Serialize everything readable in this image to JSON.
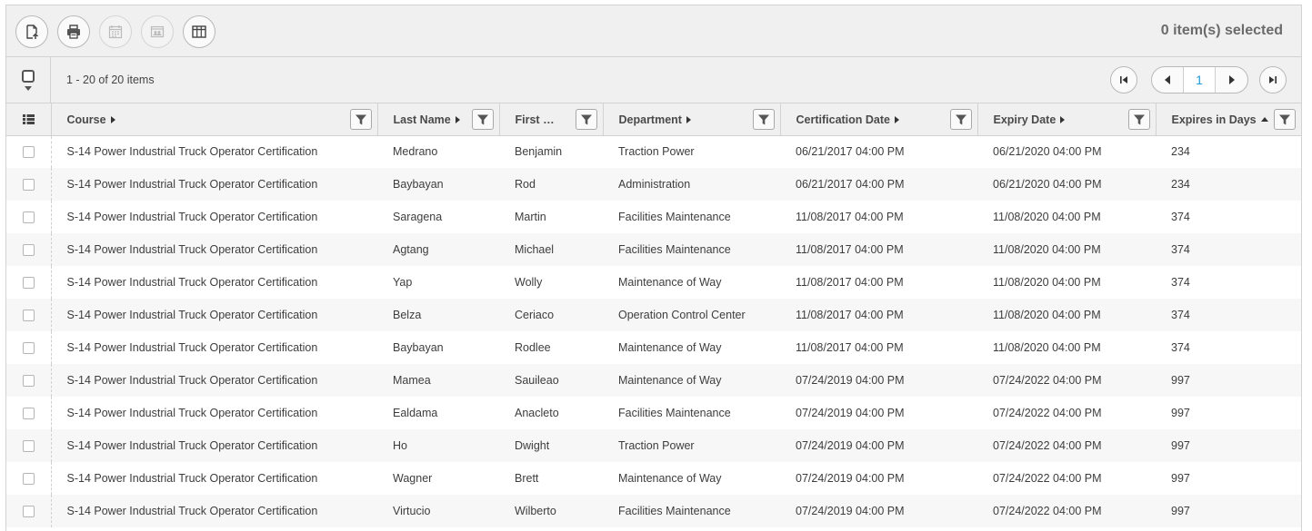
{
  "toolbar": {
    "buttons": [
      {
        "name": "export-icon",
        "enabled": true
      },
      {
        "name": "print-icon",
        "enabled": true
      },
      {
        "name": "calendar-icon",
        "enabled": false
      },
      {
        "name": "contact-card-icon",
        "enabled": false
      },
      {
        "name": "columns-icon",
        "enabled": true
      }
    ],
    "selected_text": "0 item(s) selected"
  },
  "pager": {
    "range_text": "1 - 20 of 20 items",
    "current_page": "1",
    "accent_color": "#1e9bd7"
  },
  "columns": [
    {
      "label": "Course",
      "sort": "none"
    },
    {
      "label": "Last Name",
      "sort": "none"
    },
    {
      "label": "First Name",
      "sort": "none"
    },
    {
      "label": "Department",
      "sort": "none"
    },
    {
      "label": "Certification Date",
      "sort": "none"
    },
    {
      "label": "Expiry Date",
      "sort": "none"
    },
    {
      "label": "Expires in Days",
      "sort": "ascending"
    }
  ],
  "rows": [
    [
      "S-14 Power Industrial Truck Operator Certification",
      "Medrano",
      "Benjamin",
      "Traction Power",
      "06/21/2017 04:00 PM",
      "06/21/2020 04:00 PM",
      "234"
    ],
    [
      "S-14 Power Industrial Truck Operator Certification",
      "Baybayan",
      "Rod",
      "Administration",
      "06/21/2017 04:00 PM",
      "06/21/2020 04:00 PM",
      "234"
    ],
    [
      "S-14 Power Industrial Truck Operator Certification",
      "Saragena",
      "Martin",
      "Facilities Maintenance",
      "11/08/2017 04:00 PM",
      "11/08/2020 04:00 PM",
      "374"
    ],
    [
      "S-14 Power Industrial Truck Operator Certification",
      "Agtang",
      "Michael",
      "Facilities Maintenance",
      "11/08/2017 04:00 PM",
      "11/08/2020 04:00 PM",
      "374"
    ],
    [
      "S-14 Power Industrial Truck Operator Certification",
      "Yap",
      "Wolly",
      "Maintenance of Way",
      "11/08/2017 04:00 PM",
      "11/08/2020 04:00 PM",
      "374"
    ],
    [
      "S-14 Power Industrial Truck Operator Certification",
      "Belza",
      "Ceriaco",
      "Operation Control Center",
      "11/08/2017 04:00 PM",
      "11/08/2020 04:00 PM",
      "374"
    ],
    [
      "S-14 Power Industrial Truck Operator Certification",
      "Baybayan",
      "Rodlee",
      "Maintenance of Way",
      "11/08/2017 04:00 PM",
      "11/08/2020 04:00 PM",
      "374"
    ],
    [
      "S-14 Power Industrial Truck Operator Certification",
      "Mamea",
      "Sauileao",
      "Maintenance of Way",
      "07/24/2019 04:00 PM",
      "07/24/2022 04:00 PM",
      "997"
    ],
    [
      "S-14 Power Industrial Truck Operator Certification",
      "Ealdama",
      "Anacleto",
      "Facilities Maintenance",
      "07/24/2019 04:00 PM",
      "07/24/2022 04:00 PM",
      "997"
    ],
    [
      "S-14 Power Industrial Truck Operator Certification",
      "Ho",
      "Dwight",
      "Traction Power",
      "07/24/2019 04:00 PM",
      "07/24/2022 04:00 PM",
      "997"
    ],
    [
      "S-14 Power Industrial Truck Operator Certification",
      "Wagner",
      "Brett",
      "Maintenance of Way",
      "07/24/2019 04:00 PM",
      "07/24/2022 04:00 PM",
      "997"
    ],
    [
      "S-14 Power Industrial Truck Operator Certification",
      "Virtucio",
      "Wilberto",
      "Facilities Maintenance",
      "07/24/2019 04:00 PM",
      "07/24/2022 04:00 PM",
      "997"
    ]
  ]
}
